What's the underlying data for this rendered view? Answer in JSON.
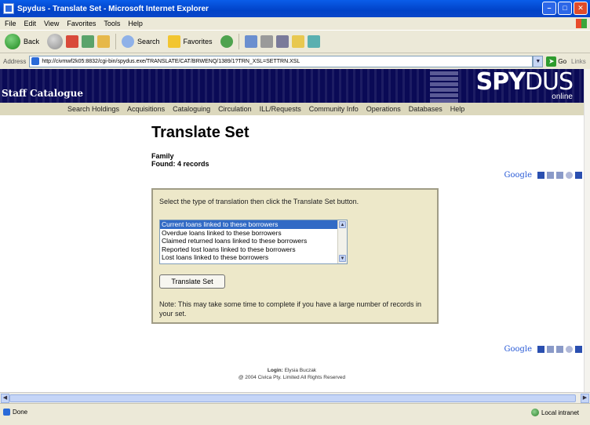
{
  "window": {
    "title": "Spydus - Translate Set - Microsoft Internet Explorer"
  },
  "menu": [
    "File",
    "Edit",
    "View",
    "Favorites",
    "Tools",
    "Help"
  ],
  "toolbar": {
    "back_label": "Back",
    "search_label": "Search",
    "favorites_label": "Favorites"
  },
  "address": {
    "label": "Address",
    "url": "http://civmwf2k05:8832/cgi-bin/spydus.exe/TRANSLATE/CAT/BRWENQ/1389/1?TRN_XSL=SETTRN.XSL",
    "go_label": "Go",
    "links_label": "Links"
  },
  "banner": {
    "left_title": "Staff Catalogue",
    "brand_a": "SPY",
    "brand_b": "DUS",
    "brand_tag": "online"
  },
  "nav": [
    "Search Holdings",
    "Acquisitions",
    "Cataloguing",
    "Circulation",
    "ILL/Requests",
    "Community Info",
    "Operations",
    "Databases",
    "Help"
  ],
  "content": {
    "heading": "Translate Set",
    "set_name": "Family",
    "found": "Found: 4 records",
    "google": "Google",
    "prompt": "Select the type of translation then click the Translate Set button.",
    "options": [
      "Current loans linked to these borrowers",
      "Overdue loans linked to these borrowers",
      "Claimed returned loans linked to these borrowers",
      "Reported lost loans linked to these borrowers",
      "Lost loans linked to these borrowers"
    ],
    "selected_option_index": 0,
    "button_label": "Translate Set",
    "note": "Note: This may take some time to complete if you have a large number of records in your set."
  },
  "footer": {
    "login_label": "Login:",
    "login_user": "Elysia Buczak",
    "copyright": "@ 2004 Civica Pty. Limited All Rights Reserved"
  },
  "status": {
    "left": "Done",
    "zone": "Local intranet"
  },
  "colors": {
    "banner": "#0a0a56",
    "nav": "#dcd8bd",
    "panel": "#ede8c9",
    "selection": "#316ac5"
  }
}
